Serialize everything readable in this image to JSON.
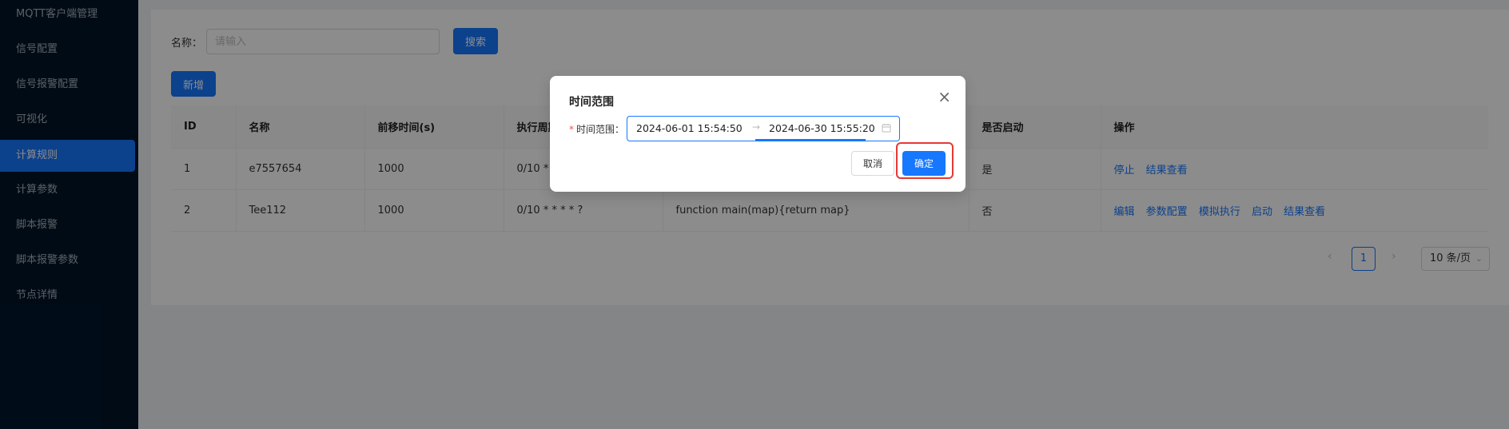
{
  "sidebar": {
    "items": [
      {
        "label": "MQTT客户端管理"
      },
      {
        "label": "信号配置"
      },
      {
        "label": "信号报警配置"
      },
      {
        "label": "可视化"
      },
      {
        "label": "计算规则"
      },
      {
        "label": "计算参数"
      },
      {
        "label": "脚本报警"
      },
      {
        "label": "脚本报警参数"
      },
      {
        "label": "节点详情"
      }
    ],
    "active_index": 4
  },
  "search": {
    "label": "名称：",
    "placeholder": "请输入",
    "button_label": "搜索"
  },
  "toolbar": {
    "add_label": "新增"
  },
  "table": {
    "columns": [
      "ID",
      "名称",
      "前移时间(s)",
      "执行周期",
      "",
      "是否启动",
      "操作"
    ],
    "rows": [
      {
        "id": "1",
        "name": "e7557654",
        "shift": "1000",
        "cron": "0/10 * *",
        "script": "",
        "enabled": "是",
        "actions": [
          "停止",
          "结果查看"
        ]
      },
      {
        "id": "2",
        "name": "Tee112",
        "shift": "1000",
        "cron": "0/10 * * * * ?",
        "script": "function main(map){return map}",
        "enabled": "否",
        "actions": [
          "编辑",
          "参数配置",
          "模拟执行",
          "启动",
          "结果查看"
        ]
      }
    ]
  },
  "pagination": {
    "current_page": "1",
    "page_size": "10 条/页"
  },
  "modal": {
    "title": "时间范围",
    "field_label": "时间范围：",
    "start": "2024-06-01 15:54:50",
    "separator": "→",
    "end": "2024-06-30 15:55:20",
    "cancel_label": "取消",
    "ok_label": "确定"
  },
  "colors": {
    "primary": "#1677ff",
    "sidebar_bg": "#001529",
    "highlight": "#e53935"
  },
  "icons": [
    "close-icon",
    "calendar-icon",
    "chevron-left-icon",
    "chevron-right-icon",
    "chevron-down-icon"
  ]
}
